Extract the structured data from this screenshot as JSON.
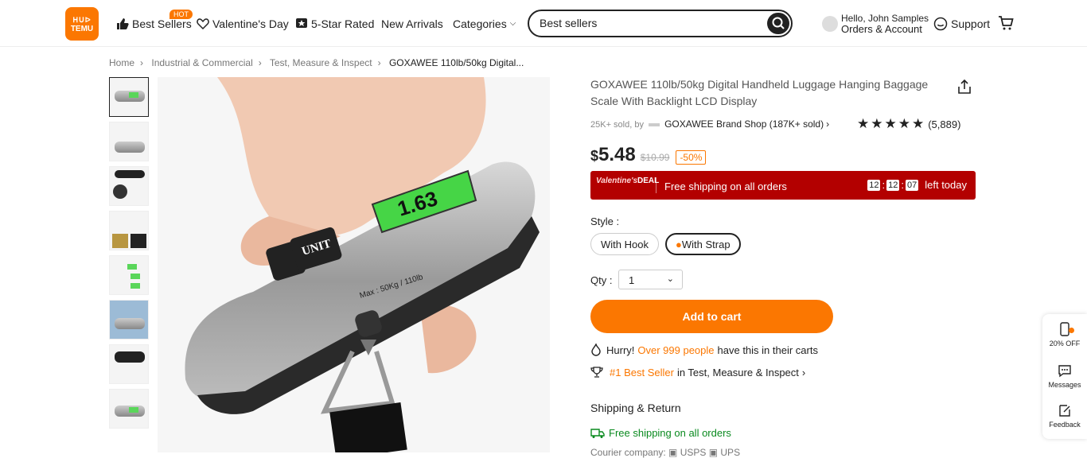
{
  "brand": {
    "logo_line1": "ᕼᑌᐅ",
    "logo_line2": "TEMU",
    "accent": "#fb7701"
  },
  "nav": {
    "best_sellers": "Best Sellers",
    "hot_badge": "HOT",
    "valentines": "Valentine's Day",
    "five_star": "5-Star Rated",
    "new_arrivals": "New Arrivals",
    "categories": "Categories"
  },
  "search": {
    "value": "Best sellers"
  },
  "account": {
    "greeting": "Hello, John Samples",
    "orders": "Orders & Account"
  },
  "support": "Support",
  "breadcrumb": [
    "Home",
    "Industrial & Commercial",
    "Test, Measure & Inspect",
    "GOXAWEE 110lb/50kg Digital..."
  ],
  "product": {
    "title": "GOXAWEE 110lb/50kg Digital Handheld Luggage Hanging Baggage Scale With Backlight LCD Display",
    "sold": "25K+ sold, by",
    "shop": "GOXAWEE Brand Shop (187K+ sold)",
    "rating_count": "(5,889)",
    "stars": "★★★★★",
    "price_currency": "$",
    "price": "5.48",
    "old_price": "$10.99",
    "discount": "-50%",
    "deal_brand": "Valentine's",
    "deal_word": "DEAL",
    "deal_text": "Free shipping on all orders",
    "timer": [
      "12",
      "12",
      "07"
    ],
    "timer_suffix": "left today",
    "style_label": "Style :",
    "styles": [
      "With Hook",
      "With Strap"
    ],
    "qty_label": "Qty :",
    "qty_value": "1",
    "add_to_cart": "Add to cart",
    "hurry_prefix": "Hurry!",
    "hurry_highlight": "Over 999 people",
    "hurry_suffix": "have this in their carts",
    "best_rank": "#1 Best Seller",
    "best_in": "in Test, Measure & Inspect",
    "shipping_header": "Shipping & Return",
    "free_shipping": "Free shipping on all orders",
    "courier": "Courier company: ▣ USPS ▣ UPS",
    "lcd_reading": "1.63",
    "unit_label": "UNIT",
    "max_label": "Max : 50Kg / 110lb"
  },
  "side": {
    "discount": "20% OFF",
    "messages": "Messages",
    "feedback": "Feedback"
  }
}
